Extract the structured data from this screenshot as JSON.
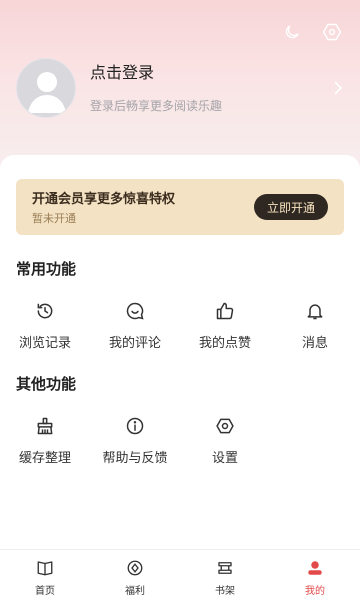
{
  "header": {
    "icons": [
      "moon-icon",
      "settings-icon"
    ]
  },
  "profile": {
    "title": "点击登录",
    "subtitle": "登录后畅享更多阅读乐趣"
  },
  "vip": {
    "title": "开通会员享更多惊喜特权",
    "status": "暂未开通",
    "button": "立即开通",
    "colors": {
      "background": "#f3e2c4",
      "button_bg": "#2e2722",
      "button_text": "#f6e2bd"
    }
  },
  "common": {
    "title": "常用功能",
    "items": [
      {
        "label": "浏览记录",
        "icon": "history-icon"
      },
      {
        "label": "我的评论",
        "icon": "comment-icon"
      },
      {
        "label": "我的点赞",
        "icon": "thumbs-up-icon"
      },
      {
        "label": "消息",
        "icon": "bell-icon"
      }
    ]
  },
  "other": {
    "title": "其他功能",
    "items": [
      {
        "label": "缓存整理",
        "icon": "broom-icon"
      },
      {
        "label": "帮助与反馈",
        "icon": "info-icon"
      },
      {
        "label": "设置",
        "icon": "settings-icon"
      }
    ]
  },
  "tabbar": {
    "items": [
      {
        "label": "首页",
        "icon": "book-icon"
      },
      {
        "label": "福利",
        "icon": "gift-icon"
      },
      {
        "label": "书架",
        "icon": "bookshelf-icon"
      },
      {
        "label": "我的",
        "icon": "profile-icon",
        "active": true
      }
    ],
    "accent": "#e24a4a"
  }
}
